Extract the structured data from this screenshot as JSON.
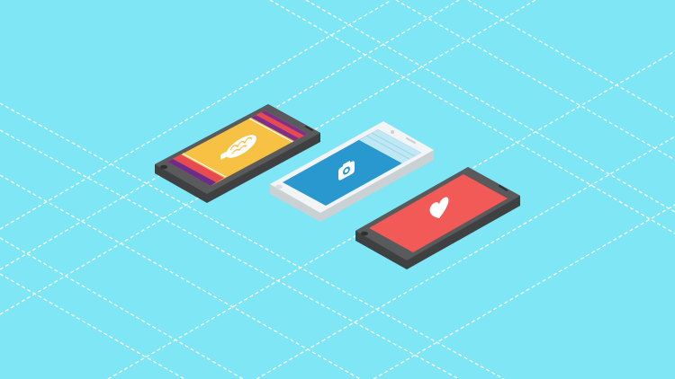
{
  "scene": {
    "background_color": "#7ee6f4",
    "grid_line_color": "#ffffff"
  },
  "phones": [
    {
      "id": "phone-left",
      "body_color": "#595a5b",
      "screen_icon": "lightbulb-brain-icon",
      "screen_colors": [
        "#f7c143",
        "#e74a4f",
        "#7b2f8e",
        "#6b2d8a"
      ]
    },
    {
      "id": "phone-center",
      "body_color": "#f2f4f5",
      "screen_icon": "camera-icon",
      "screen_colors": [
        "#2998cf",
        "#bfe8f4",
        "#9fd8ea"
      ]
    },
    {
      "id": "phone-right",
      "body_color": "#595a5b",
      "screen_icon": "heart-icon",
      "screen_colors": [
        "#f25a57"
      ]
    }
  ]
}
